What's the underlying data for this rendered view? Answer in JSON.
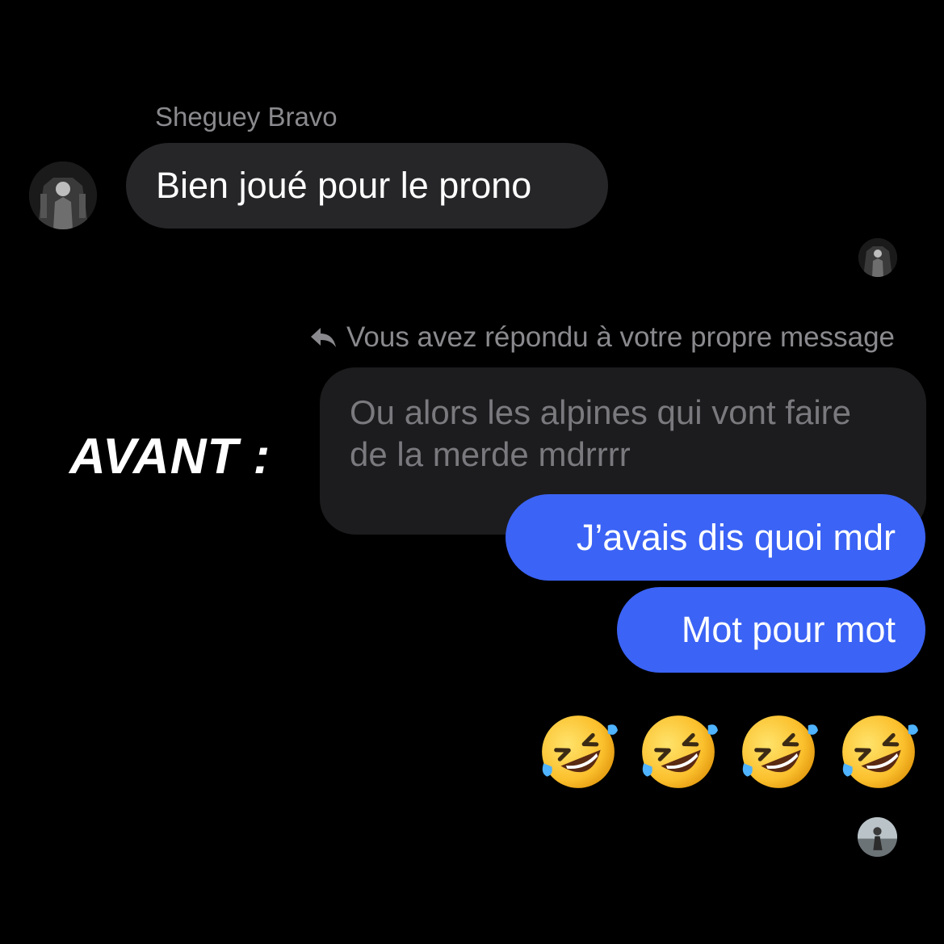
{
  "chat": {
    "sender_name": "Sheguey Bravo",
    "incoming_message": "Bien joué pour le prono",
    "reply_notice": "Vous avez répondu à votre propre message",
    "quoted_message_line1": "Ou alors les alpines qui vont faire",
    "quoted_message_line2": "de la merde mdrrrr",
    "outgoing_messages": [
      "J’avais dis quoi mdr",
      "Mot pour mot"
    ],
    "emoji_message": {
      "icon": "rolling-on-the-floor-laughing-emoji",
      "count": 4
    }
  },
  "overlay": {
    "label": "AVANT :"
  },
  "colors": {
    "background": "#000000",
    "incoming_bubble": "#262629",
    "quoted_bubble": "#1c1c1e",
    "outgoing_bubble": "#3b63f5",
    "meta_text": "#8a8a8e"
  }
}
